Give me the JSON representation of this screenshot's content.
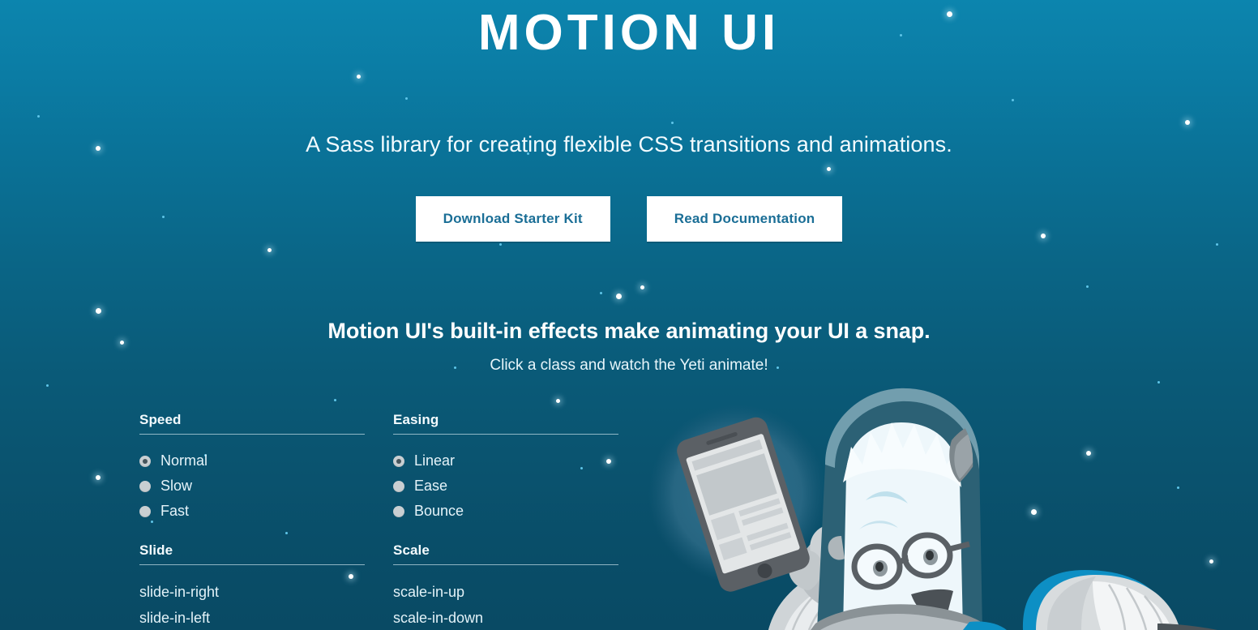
{
  "hero": {
    "title": "MOTION UI",
    "tagline": "A Sass library for creating flexible CSS transitions and animations.",
    "buttons": [
      {
        "label": "Download Starter Kit",
        "name": "download-starter-kit-button"
      },
      {
        "label": "Read Documentation",
        "name": "read-documentation-button"
      }
    ]
  },
  "demo": {
    "heading": "Motion UI's built-in effects make animating your UI a snap.",
    "note": "Click a class and watch the Yeti animate!"
  },
  "controls": {
    "speed": {
      "title": "Speed",
      "options": [
        {
          "label": "Normal",
          "selected": true
        },
        {
          "label": "Slow",
          "selected": false
        },
        {
          "label": "Fast",
          "selected": false
        }
      ]
    },
    "easing": {
      "title": "Easing",
      "options": [
        {
          "label": "Linear",
          "selected": true
        },
        {
          "label": "Ease",
          "selected": false
        },
        {
          "label": "Bounce",
          "selected": false
        }
      ]
    },
    "slide": {
      "title": "Slide",
      "items": [
        "slide-in-right",
        "slide-in-left"
      ]
    },
    "scale": {
      "title": "Scale",
      "items": [
        "scale-in-up",
        "scale-in-down"
      ]
    }
  },
  "illustration": {
    "name": "yeti-astronaut-holding-phone",
    "alt": "Yeti astronaut in a space helmet holding a smartphone"
  },
  "colors": {
    "bg_top": "#0c85ae",
    "bg_bottom": "#094a64",
    "button_bg": "#ffffff",
    "button_text": "#1a6e96",
    "text": "#ffffff",
    "suit_accent": "#0d8fc4",
    "glow": "#2e6b85"
  }
}
